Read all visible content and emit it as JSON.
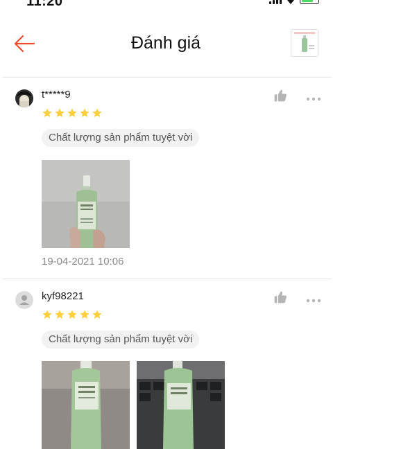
{
  "status": {
    "time": "11:20"
  },
  "header": {
    "title": "Đánh giá"
  },
  "reviews": [
    {
      "username": "t*****9",
      "rating": 5,
      "tag": "Chất lượng sản phẩm tuyệt vời",
      "date": "19-04-2021 10:06"
    },
    {
      "username": "kyf98221",
      "rating": 5,
      "tag": "Chất lượng sản phẩm tuyệt vời"
    }
  ],
  "icons": {
    "back": "arrow-left-icon",
    "like": "thumbs-up-icon",
    "more": "more-horizontal-icon",
    "star": "star-icon",
    "default_avatar": "user-icon"
  },
  "colors": {
    "accent": "#ee4d2d",
    "star": "#ffce3d",
    "icon_gray": "#b5b5b5",
    "divider": "#e6e6e6"
  }
}
